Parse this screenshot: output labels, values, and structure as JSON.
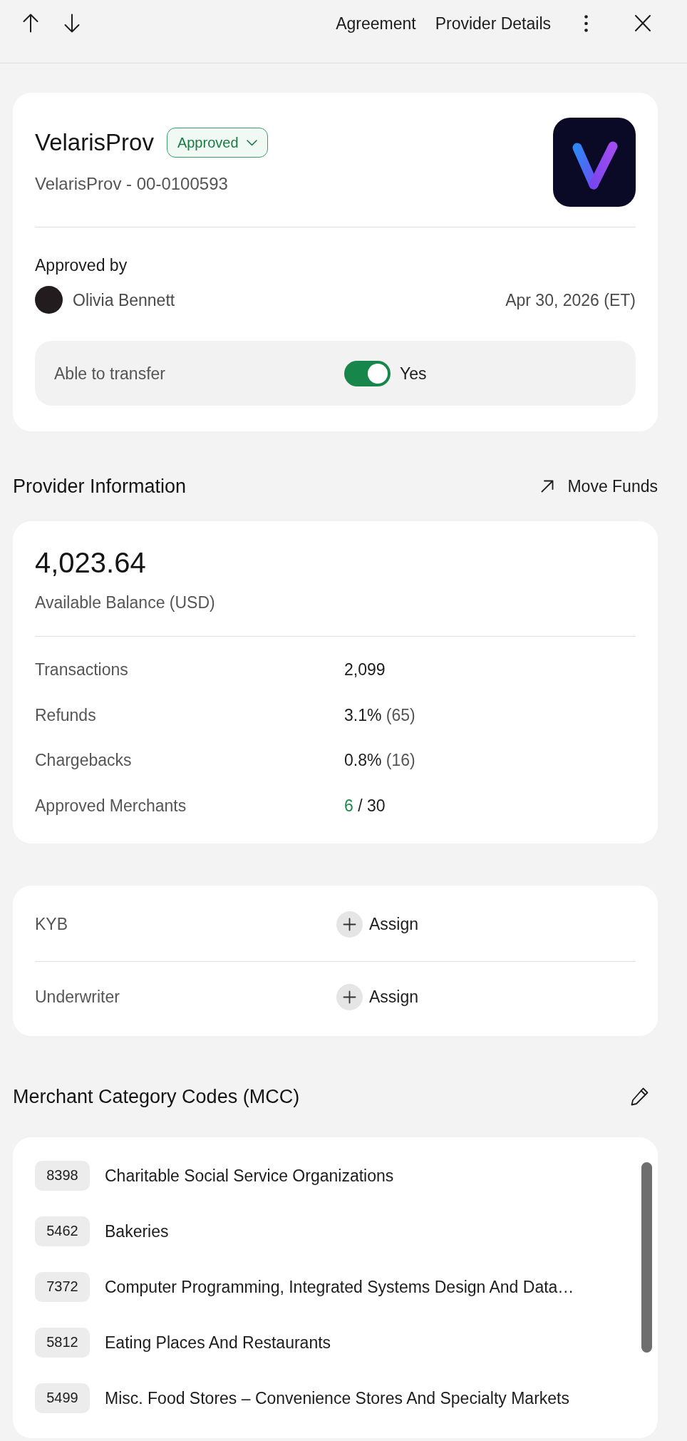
{
  "toolbar": {
    "links": [
      "Agreement",
      "Provider Details"
    ]
  },
  "provider": {
    "name": "VelarisProv",
    "status": {
      "label": "Approved",
      "kind": "approved"
    },
    "subtitle": "VelarisProv - 00-0100593",
    "approved_by": {
      "label": "Approved by",
      "name": "Olivia Bennett",
      "date": "Apr 30, 2026 (ET)"
    },
    "transfer": {
      "label": "Able to transfer",
      "on": true,
      "value": "Yes"
    }
  },
  "provider_information": {
    "title": "Provider Information",
    "action": "Move Funds",
    "balance": "4,023.64",
    "balance_label": "Available Balance (USD)",
    "stats": [
      {
        "kind": "plain",
        "label": "Transactions",
        "value": "2,099"
      },
      {
        "kind": "count",
        "label": "Refunds",
        "value": "3.1%",
        "note": "(65)"
      },
      {
        "kind": "count",
        "label": "Chargebacks",
        "value": "0.8%",
        "note": "(16)"
      },
      {
        "kind": "ratio",
        "label": "Approved Merchants",
        "value": "6",
        "note": "/ 30"
      }
    ]
  },
  "assignments": [
    {
      "label": "KYB",
      "action": "Assign"
    },
    {
      "label": "Underwriter",
      "action": "Assign"
    }
  ],
  "mcc": {
    "title": "Merchant Category Codes (MCC)",
    "codes": [
      {
        "code": "8398",
        "name": "Charitable Social Service Organizations"
      },
      {
        "code": "5462",
        "name": "Bakeries"
      },
      {
        "code": "7372",
        "name": "Computer Programming, Integrated Systems Design And Data…"
      },
      {
        "code": "5812",
        "name": "Eating Places And Restaurants"
      },
      {
        "code": "5499",
        "name": "Misc. Food Stores – Convenience Stores And Specialty Markets"
      }
    ]
  }
}
